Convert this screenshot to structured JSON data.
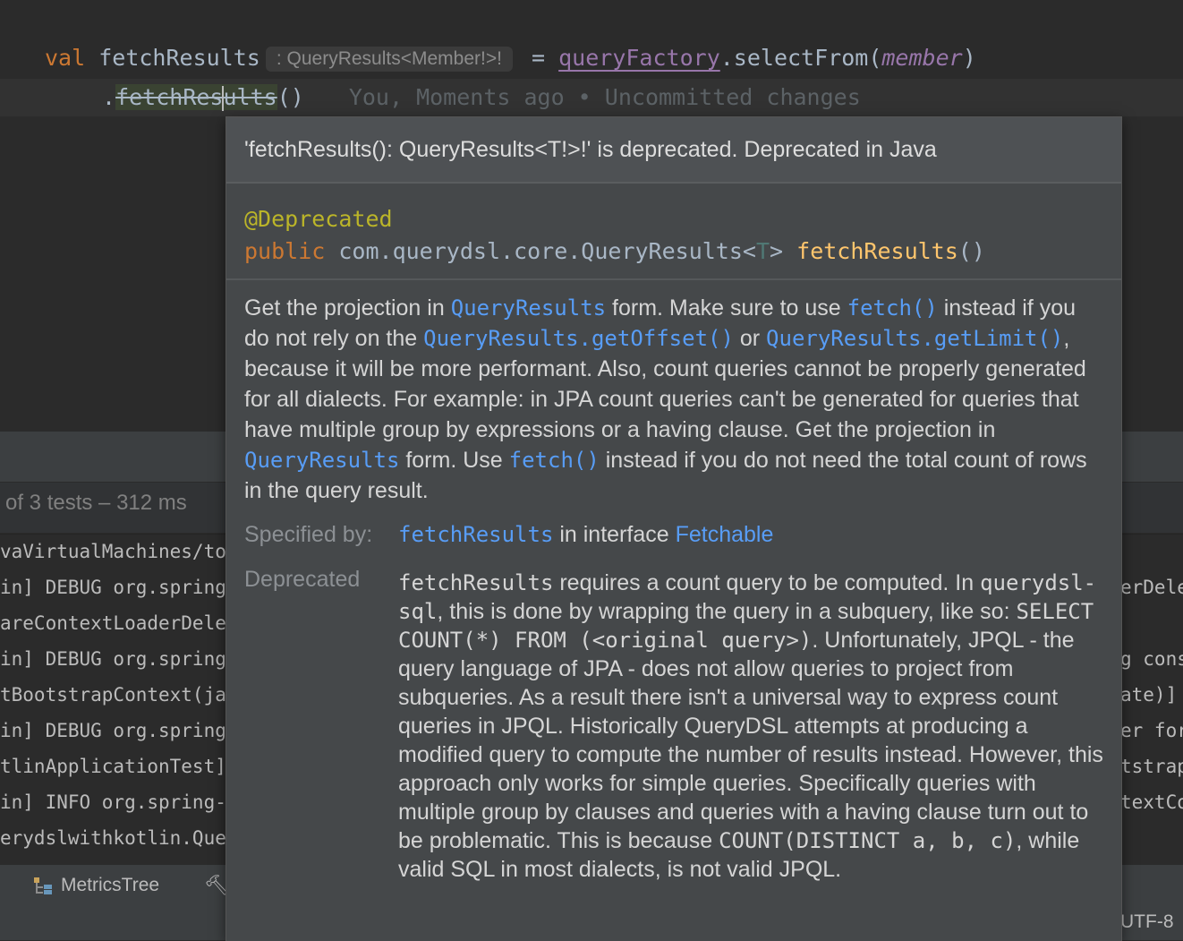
{
  "editor": {
    "line1": {
      "keyword": "val",
      "name": "fetchResults",
      "type_hint": ": QueryResults<Member!>!",
      "assign": "=",
      "receiver": "queryFactory",
      "call": ".selectFrom(",
      "arg": "member",
      "close": ")"
    },
    "line2": {
      "dot": ".",
      "method_a": "fetchRes",
      "method_b": "ults",
      "parens": "()",
      "blame": "You, Moments ago • Uncommitted changes"
    }
  },
  "tests": {
    "summary": "of 3 tests – 312 ms"
  },
  "console": {
    "left": [
      "vaVirtualMachines/to",
      "in] DEBUG org.spring",
      "areContextLoaderDele",
      "in] DEBUG org.spring",
      "tBootstrapContext(ja",
      "in] DEBUG org.spring",
      "tlinApplicationTest]",
      "in] INFO org.spring-",
      "erydslwithkotlin.Que"
    ],
    "right": [
      "erDele",
      "g cons",
      "ate)]",
      "er for",
      "tstrap",
      "textCo"
    ]
  },
  "bottom_bar": {
    "metrics_tab": "MetricsTree",
    "encoding": "UTF-8"
  },
  "popup": {
    "header": "'fetchResults(): QueryResults<T!>!' is deprecated. Deprecated in Java",
    "signature": {
      "annotation": "@Deprecated",
      "modifier": "public",
      "return_type": "com.querydsl.core.QueryResults<",
      "generic": "T",
      "return_close": ">",
      "method": "fetchResults",
      "parens": "()"
    },
    "description": {
      "t1": "Get the projection in ",
      "l1": "QueryResults",
      "t2": " form. Make sure to use ",
      "l2": "fetch()",
      "t3": " instead if you do not rely on the ",
      "l3": "QueryResults.getOffset()",
      "t4": " or ",
      "l4": "QueryResults.getLimit()",
      "t5": ", because it will be more performant. Also, count queries cannot be properly generated for all dialects. For example: in JPA count queries can't be generated for queries that have multiple group by expressions or a having clause. Get the projection in ",
      "l5": "QueryResults",
      "t6": " form. Use ",
      "l6": "fetch()",
      "t7": " instead if you do not need the total count of rows in the query result."
    },
    "specified_by": {
      "label": "Specified by:",
      "method": "fetchResults",
      "text": " in interface ",
      "interface": "Fetchable"
    },
    "deprecated": {
      "label": "Deprecated",
      "c1": "fetchResults",
      "t1": " requires a count query to be computed. In ",
      "c2": "querydsl-sql",
      "t2": ", this is done by wrapping the query in a subquery, like so: ",
      "c3": "SELECT COUNT(*) FROM (<original query>)",
      "t3": ". Unfortunately, JPQL - the query language of JPA - does not allow queries to project from subqueries. As a result there isn't a universal way to express count queries in JPQL. Historically QueryDSL attempts at producing a modified query to compute the number of results instead. However, this approach only works for simple queries. Specifically queries with multiple group by clauses and queries with a having clause turn out to be problematic. This is because ",
      "c4": "COUNT(DISTINCT a, b, c)",
      "t4": ", while valid SQL in most dialects, is not valid JPQL."
    }
  }
}
